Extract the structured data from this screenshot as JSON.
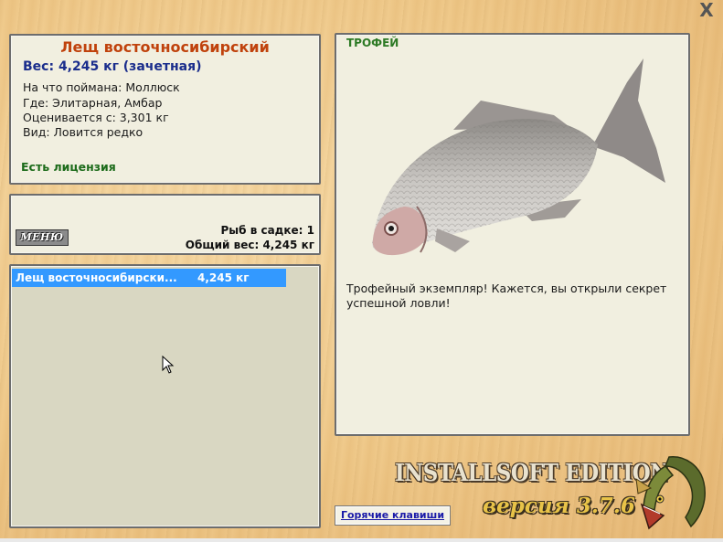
{
  "window": {
    "close_symbol": "X"
  },
  "info_panel": {
    "fish_name": "Лещ восточносибирский",
    "weight": "Вес: 4,245 кг (зачетная)",
    "bait": "На что поймана: Моллюск",
    "location": "Где: Элитарная, Амбар",
    "valued_from": "Оценивается с: 3,301 кг",
    "rarity": "Вид: Ловится редко",
    "license": "Есть лицензия"
  },
  "keepnet_panel": {
    "menu_label": "МЕНЮ",
    "fish_count": "Рыб в садке: 1",
    "total_weight": "Общий вес: 4,245 кг"
  },
  "catch_list": [
    {
      "name": "Лещ восточносибирски...",
      "weight": "4,245 кг"
    }
  ],
  "trophy_panel": {
    "label": "ТРОФЕЙ",
    "description": "Трофейный экземпляр! Кажется, вы открыли секрет успешной ловли!",
    "image_icon": "bream-fish-image"
  },
  "footer": {
    "hotkeys_label": "Горячие клавиши",
    "brand": "INSTALLSOFT EDITION",
    "version": "версия 3.7.6",
    "logo_icon": "pike-logo-icon"
  }
}
